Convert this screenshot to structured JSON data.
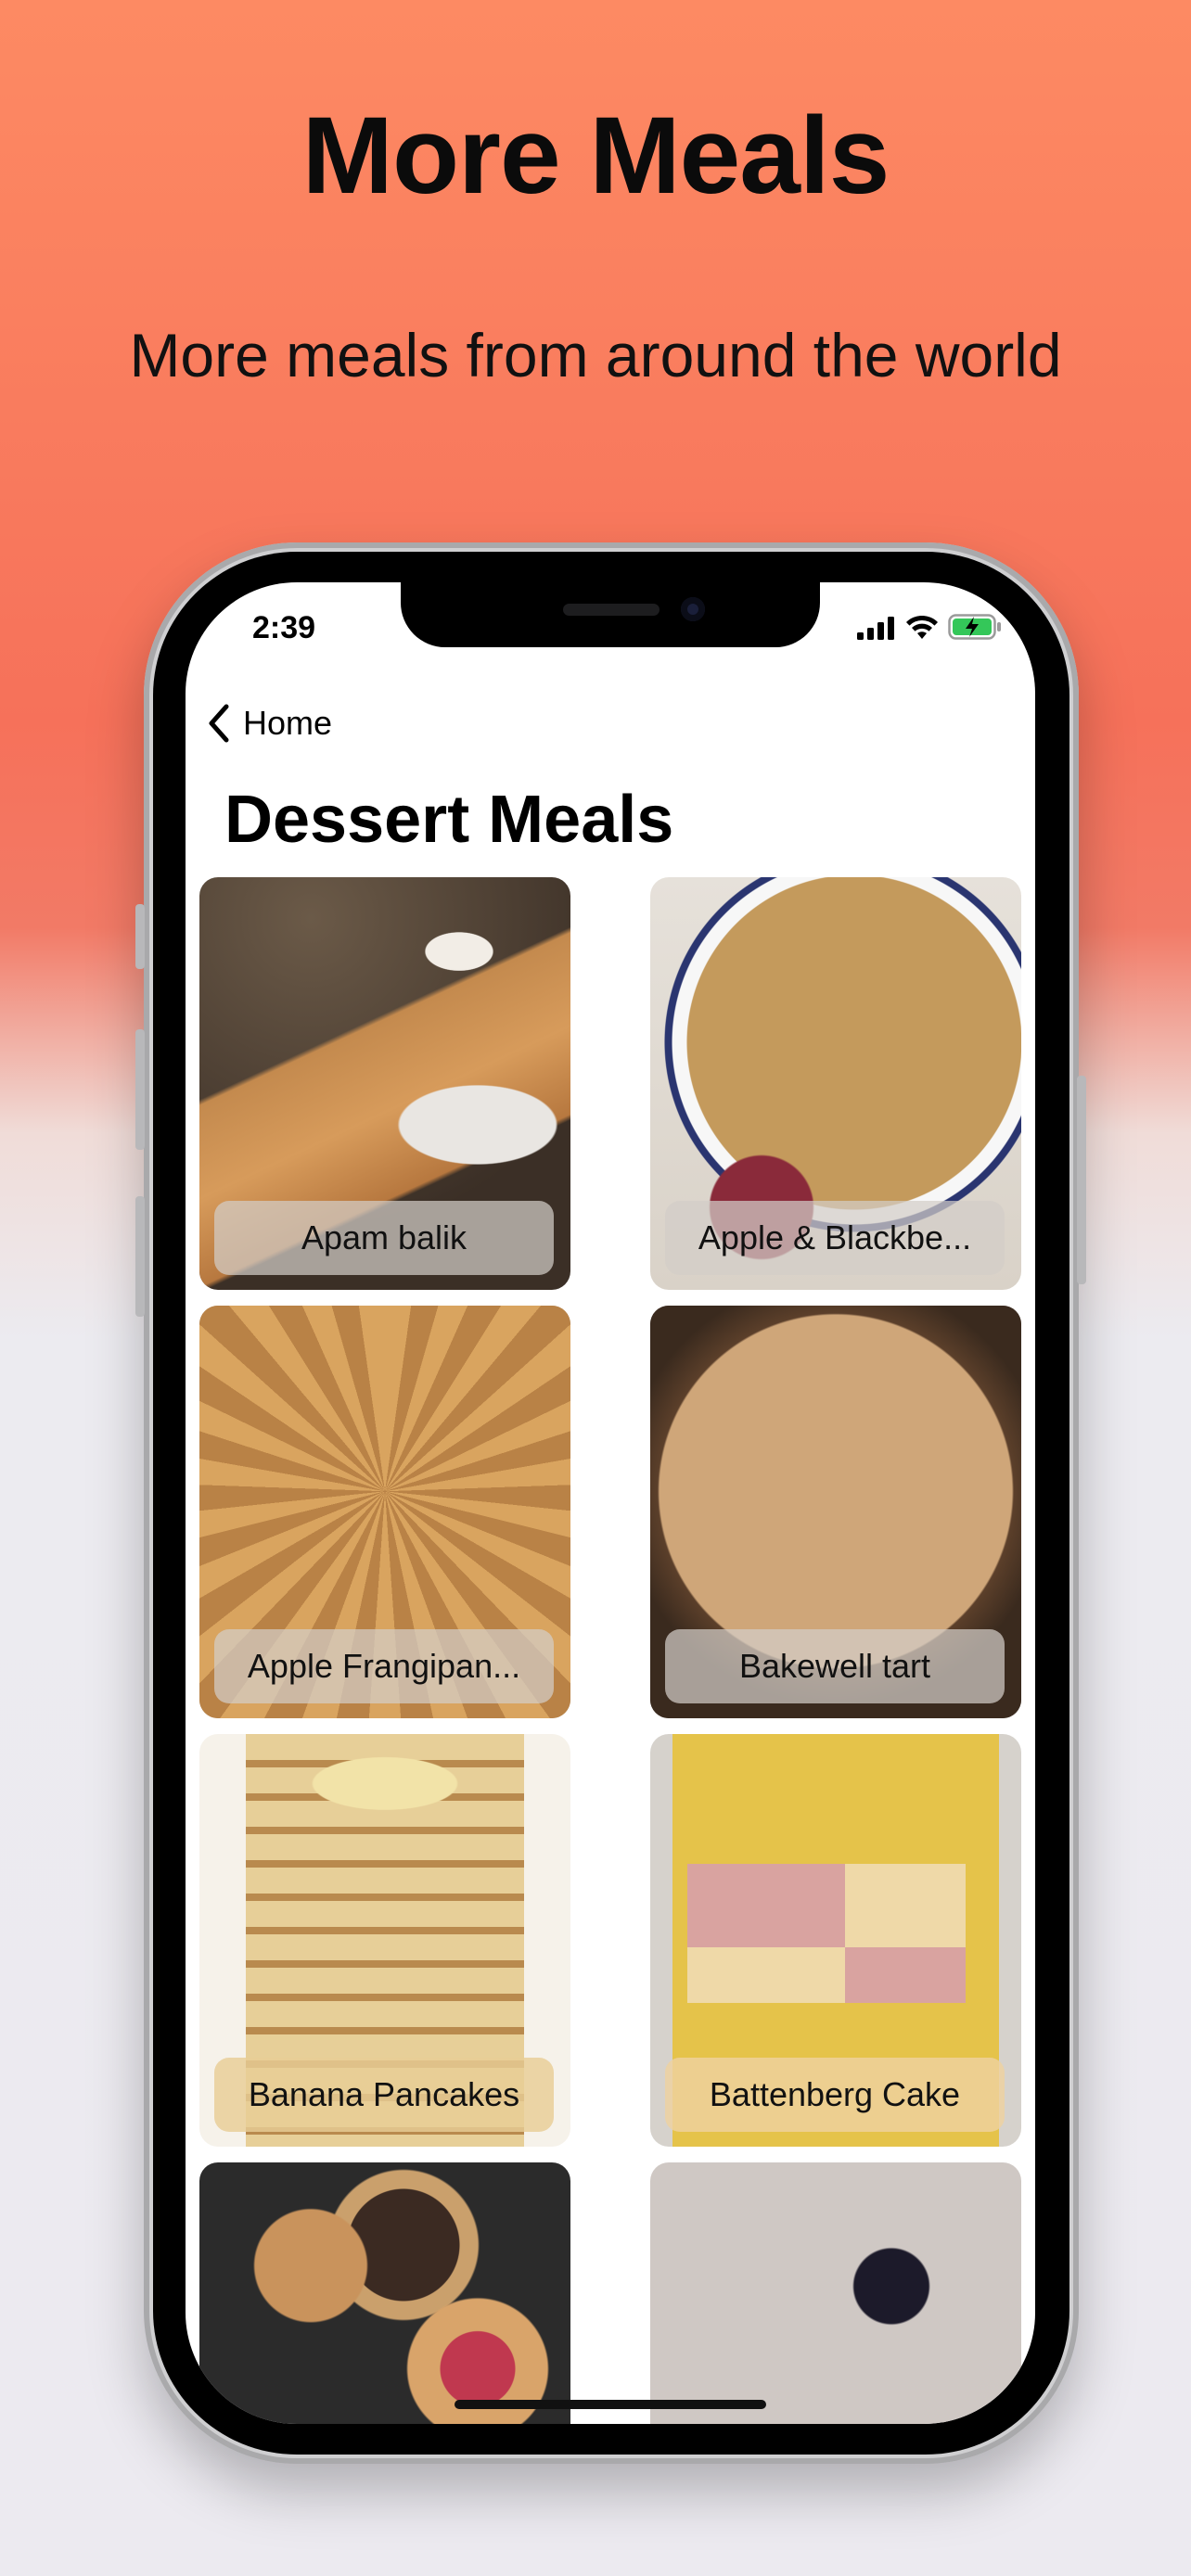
{
  "hero": {
    "title": "More Meals",
    "subtitle": "More meals from around the world"
  },
  "status_bar": {
    "time": "2:39",
    "icons": [
      "cellular-signal-icon",
      "wifi-icon",
      "battery-charging-icon"
    ]
  },
  "nav": {
    "back_label": "Home",
    "back_icon": "chevron-left-icon"
  },
  "page": {
    "title": "Dessert Meals"
  },
  "meals": [
    {
      "name": "Apam balik"
    },
    {
      "name": "Apple & Blackbe..."
    },
    {
      "name": "Apple Frangipan..."
    },
    {
      "name": "Bakewell tart"
    },
    {
      "name": "Banana Pancakes"
    },
    {
      "name": "Battenberg Cake"
    },
    {
      "name": ""
    },
    {
      "name": ""
    }
  ],
  "colors": {
    "hero_gradient_top": "#fd8a63",
    "hero_gradient_mid": "#f6715a",
    "page_background": "#eceaf0",
    "battery_fill": "#34c759"
  }
}
